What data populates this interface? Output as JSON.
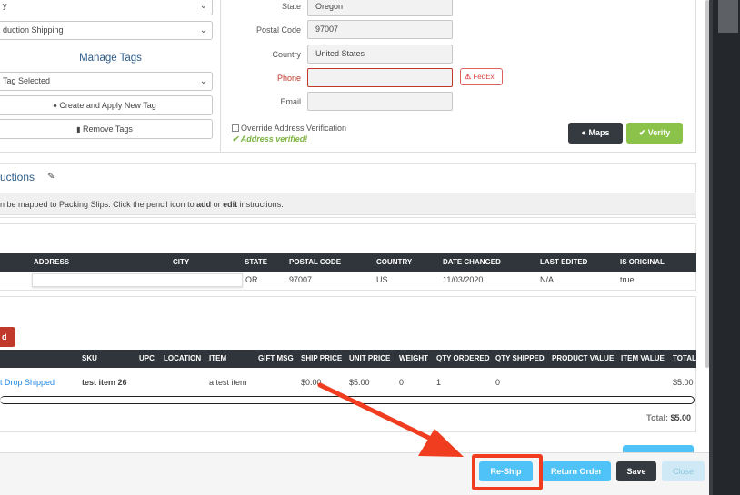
{
  "left_panel": {
    "select1": "y",
    "select2": "duction Shipping",
    "manage_tags_title": "Manage Tags",
    "tag_select": "Tag Selected",
    "create_tag_button": "Create and Apply New Tag",
    "remove_tags_button": "Remove Tags"
  },
  "address_form": {
    "state_label": "State",
    "state_value": "Oregon",
    "postal_label": "Postal Code",
    "postal_value": "97007",
    "country_label": "Country",
    "country_value": "United States",
    "phone_label": "Phone",
    "phone_value": "",
    "fedex_badge": "FedEx",
    "email_label": "Email",
    "email_value": "",
    "override_label": "Override Address Verification",
    "verified_text": "Address verified!",
    "maps_button": "Maps",
    "verify_button": "Verify"
  },
  "instructions": {
    "title": "uctions",
    "text_pre": "n be mapped to Packing Slips. Click the pencil icon to ",
    "text_add": "add",
    "text_or": " or ",
    "text_edit": "edit",
    "text_post": " instructions."
  },
  "address_history": {
    "headers": [
      "ADDRESS",
      "CITY",
      "STATE",
      "POSTAL CODE",
      "COUNTRY",
      "DATE CHANGED",
      "LAST EDITED",
      "IS ORIGINAL"
    ],
    "row": {
      "state": "OR",
      "postal": "97007",
      "country": "US",
      "date": "11/03/2020",
      "last_edited": "N/A",
      "is_original": "true"
    }
  },
  "items": {
    "red_button": "d",
    "headers": [
      "SKU",
      "UPC",
      "LOCATION",
      "ITEM",
      "GIFT MSG",
      "SHIP PRICE",
      "UNIT PRICE",
      "WEIGHT",
      "QTY ORDERED",
      "QTY SHIPPED",
      "PRODUCT VALUE",
      "ITEM VALUE",
      "TOTAL"
    ],
    "row": {
      "name": "t Drop Shipped",
      "sku": "test item 26",
      "item": "a test item",
      "ship_price": "$0.00",
      "unit_price": "$5.00",
      "weight": "0",
      "qty_ordered": "1",
      "qty_shipped": "0",
      "total": "$5.00"
    },
    "total_label": "Total:",
    "total_value": "$5.00"
  },
  "footer": {
    "reship_button": "Re-Ship",
    "return_order_button": "Return Order",
    "save_button": "Save",
    "close_button": "Close"
  },
  "colors": {
    "accent": "#4fc3f7",
    "dark": "#343a40",
    "verify_green": "#8bc34a",
    "annotation_red": "#f03c1f"
  }
}
